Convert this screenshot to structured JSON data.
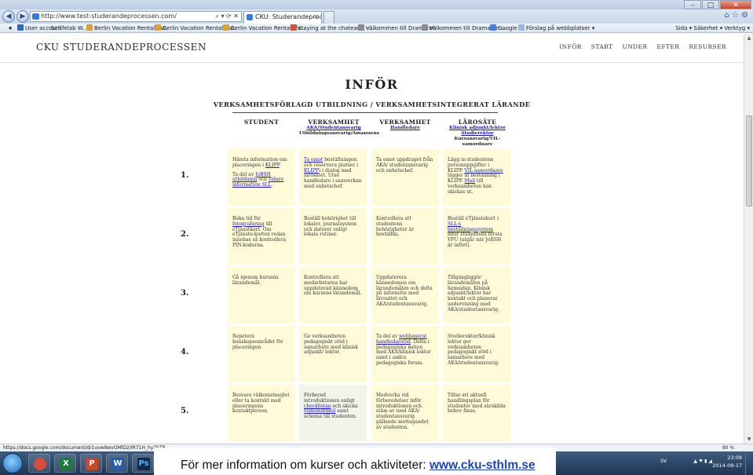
{
  "browser": {
    "address": "http://www.test-studerandeprocessen.com/",
    "tabs": [
      {
        "label": "CKU: Studerandeprocessen"
      }
    ],
    "favorites": [
      "User account",
      "Scilifelab W...",
      "Berlin Vacation Rental - V...",
      "Berlin Vacation Rental - V...",
      "Berlin Vacation Rental - V...",
      "staying at the chateaux - ...",
      "Välkommen till Dramaten",
      "Välkommen till Dramaten ...",
      "Google",
      "Förslag på webbplatser ▾"
    ],
    "tools": "Sida ▾  Säkerhet ▾  Verktyg ▾",
    "status_url": "https://docs.google.com/document/d/1uvw8wvOMlD2/IR71H_hy7hTP",
    "zoom": "90 %"
  },
  "site": {
    "title": "CKU STUDERANDEPROCESSEN",
    "nav": [
      "INFÖR",
      "START",
      "UNDER",
      "EFTER",
      "RESURSER"
    ]
  },
  "main": {
    "heading": "INFÖR",
    "subheading": "VERKSAMHETSFÖRLAGD UTBILDNING / VERKSAMHETSINTEGRERAT LÄRANDE",
    "columns": [
      {
        "main": "STUDENT",
        "sub": "",
        "sub2": ""
      },
      {
        "main": "VERKSAMHET",
        "sub": "AKA/Studentansvarig",
        "sub2": "Utbildningsansvarig/Amanuens"
      },
      {
        "main": "VERKSAMHET",
        "sub": "Handledare",
        "sub2": ""
      },
      {
        "main": "LÄROSÄTE",
        "sub": "Klinisk adjunkt/lektor Studierektor",
        "sub2": "Kursansvarig/VIL-samordnare"
      }
    ],
    "rows": [
      {
        "num": "1.",
        "cells": [
          [
            [
              "Hämta information om placeringen i "
            ],
            [
              "KLIPP",
              "link"
            ],
            [
              "."
            ]
          ],
          [
            [
              "Ta emot",
              "link"
            ],
            [
              " beställningen och reservera platser i "
            ],
            [
              "KLIPP",
              "link"
            ],
            [
              ") i dialog med lärosätet. Utse handledare i samverkan med enhetschef."
            ]
          ],
          [
            [
              "Ta emot uppdraget från AKA/ studentansvarig och enhetschef."
            ]
          ],
          [
            [
              "Lägg in studentens personuppgifter i KLIPP. "
            ],
            [
              "VIL-samordnare",
              "link"
            ],
            [
              " lägger in beställning i KLIPP. "
            ],
            [
              "Mail",
              "link"
            ],
            [
              " till verksamheten kan skickas ut."
            ]
          ]
        ],
        "extra": [
          [
            "Ta del av "
          ],
          [
            "JoBSH utbildning",
            "link"
          ],
          [
            " och "
          ],
          [
            "vidare information SLL",
            "link"
          ],
          [
            "."
          ]
        ]
      },
      {
        "num": "2.",
        "cells": [
          [
            [
              "Boka tid för "
            ],
            [
              "fotografering",
              "link"
            ],
            [
              " till eTjänstkort. Om eTjänste-korten redan innehas så kontrollera PIN-koderna."
            ]
          ],
          [
            [
              "Beställ behörighet till lokaler, journalsystem och datorer enligt lokala rutiner."
            ]
          ],
          [
            [
              "Kontrollera att studentens behörigheter är beställda."
            ]
          ],
          [
            [
              "Beställ eTjänstekort i "
            ],
            [
              "SLL:s beställningssystem",
              "link"
            ],
            [
              " inför studentens första VFU (utgår när JoBSH är infört)."
            ]
          ]
        ]
      },
      {
        "num": "3.",
        "cells": [
          [
            [
              "Gå igenom kursens lärandemål."
            ]
          ],
          [
            [
              "Kontrollera att medarbetarna har uppdaterad kännedom om kursens lärandemål."
            ]
          ],
          [
            [
              "Uppdaterera kännedomen om lärandemålen och delta på informöte med lärosätet och AKA/studentansvarig."
            ]
          ],
          [
            [
              "Tillgängliggör lärandemålen på hemsidan. Klinisk adjunkt/lektor har kontakt och planerar undervisning med AKA/studentansvarig."
            ]
          ]
        ]
      },
      {
        "num": "4.",
        "cells": [
          [
            [
              "Repetera kunskapsområdet för placeringen."
            ]
          ],
          [
            [
              "Ge verksamheten pedagogiskt stöd i samarbete med klinisk adjunkt/ lektor."
            ]
          ],
          [
            [
              "Ta del av "
            ],
            [
              "webbaserat handledarstöd",
              "link"
            ],
            [
              ". Delta i pedagogiska möten med AKA/klinisk lektor samt i andra pedagogiska forum."
            ]
          ],
          [
            [
              "Studierektor/klinisk lektor ger verksamheten pedagogiskt stöd i samarbete med AKA/studentansvarig."
            ]
          ]
        ]
      },
      {
        "num": "5.",
        "cells": [
          [
            [
              "Besvara välkomstmejlet eller ta kontakt med placeringens kontaktperson."
            ]
          ],
          [
            [
              "Förbered introduktionen enligt "
            ],
            [
              "checklistan",
              "link"
            ],
            [
              " och skicka "
            ],
            [
              "välkomstmejl",
              "link"
            ],
            [
              " samt schema  till studenten."
            ]
          ],
          [
            [
              "Medverka vid förberedelser inför introduktionen och stäm av med AKA/ studentansvarig gällande mottagandet av studenten."
            ]
          ],
          [
            [
              "Tillse att aktuell handlingsplan för studenter med särskilda behov finns."
            ]
          ]
        ]
      }
    ]
  },
  "taskbar": {
    "apps": [
      "Chrome",
      "Excel",
      "PowerPoint",
      "Word",
      "Photoshop",
      "Explorer"
    ],
    "lang": "SV",
    "time": "23:08",
    "date": "2014-09-17"
  },
  "banner": {
    "text": "För mer information om kurser och aktiviteter: ",
    "url": "www.cku-sthlm.se"
  }
}
